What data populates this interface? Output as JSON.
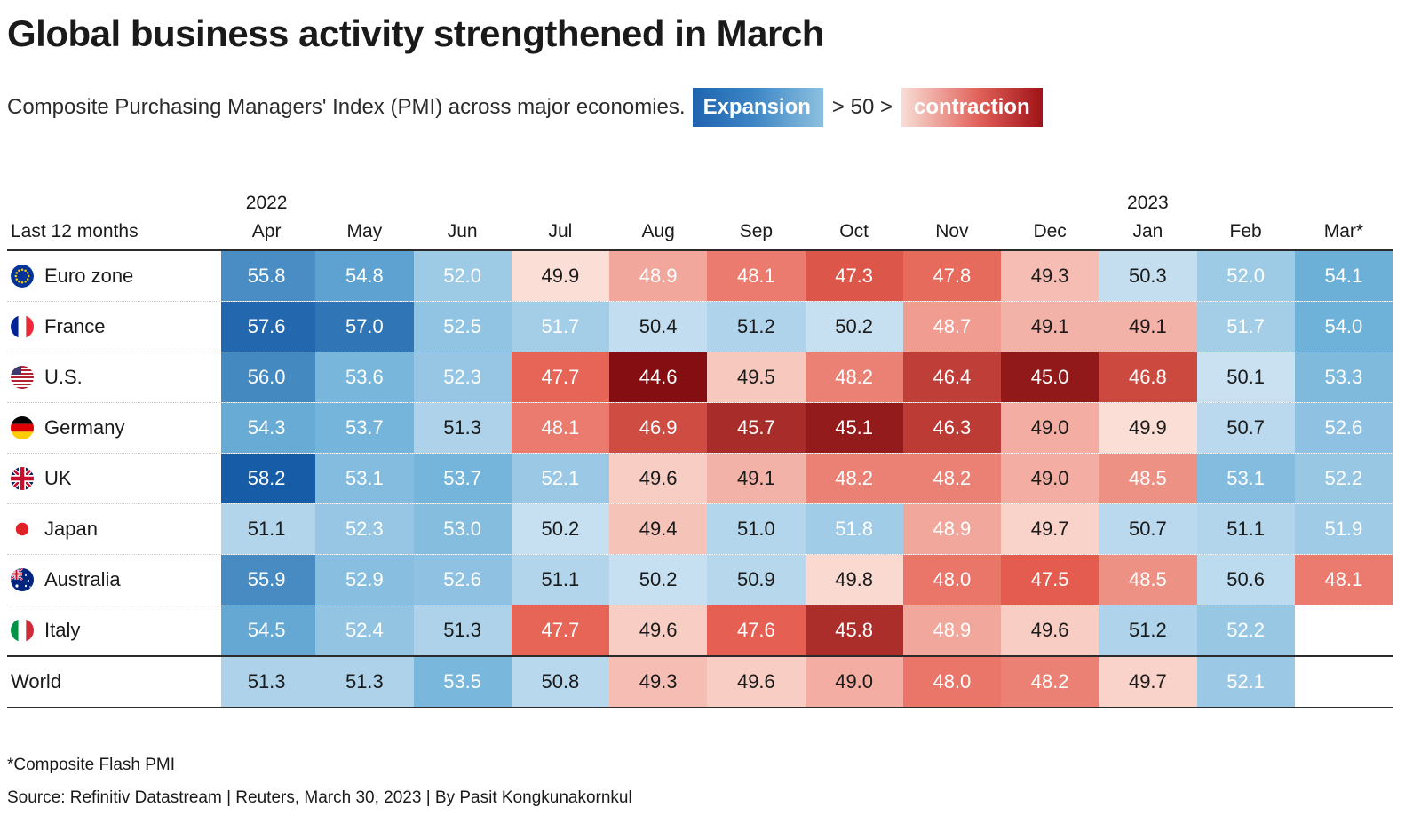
{
  "header": {
    "title": "Global business activity strengthened in March",
    "subtitle": "Composite Purchasing Managers' Index (PMI) across major economies.",
    "legend": {
      "expansion_label": "Expansion",
      "middle_label": "> 50 >",
      "contraction_label": "contraction",
      "expansion_color_dark": "#1f63ae",
      "expansion_color_light": "#8cc0e0",
      "contraction_color_light": "#f8ded6",
      "contraction_color_dark": "#a01217"
    }
  },
  "footer": {
    "footnote": "*Composite Flash PMI",
    "source": "Source: Refinitiv Datastream | Reuters, March 30, 2023 | By Pasit Kongkunakornkul"
  },
  "chart_data": {
    "type": "heatmap",
    "title": "Global business activity strengthened in March",
    "subtitle": "Composite Purchasing Managers' Index (PMI) across major economies.",
    "xlabel": "",
    "ylabel": "",
    "row_header_label": "Last 12 months",
    "year_labels": [
      {
        "text": "2022",
        "column": "Apr"
      },
      {
        "text": "2023",
        "column": "Jan"
      }
    ],
    "categories": [
      "Apr",
      "May",
      "Jun",
      "Jul",
      "Aug",
      "Sep",
      "Oct",
      "Nov",
      "Dec",
      "Jan",
      "Feb",
      "Mar*"
    ],
    "rows": [
      {
        "name": "Euro zone",
        "flag": "eu-flag-icon",
        "values": [
          55.8,
          54.8,
          52.0,
          49.9,
          48.9,
          48.1,
          47.3,
          47.8,
          49.3,
          50.3,
          52.0,
          54.1
        ]
      },
      {
        "name": "France",
        "flag": "france-flag-icon",
        "values": [
          57.6,
          57.0,
          52.5,
          51.7,
          50.4,
          51.2,
          50.2,
          48.7,
          49.1,
          49.1,
          51.7,
          54.0
        ]
      },
      {
        "name": "U.S.",
        "flag": "usa-flag-icon",
        "values": [
          56.0,
          53.6,
          52.3,
          47.7,
          44.6,
          49.5,
          48.2,
          46.4,
          45.0,
          46.8,
          50.1,
          53.3
        ]
      },
      {
        "name": "Germany",
        "flag": "germany-flag-icon",
        "values": [
          54.3,
          53.7,
          51.3,
          48.1,
          46.9,
          45.7,
          45.1,
          46.3,
          49.0,
          49.9,
          50.7,
          52.6
        ]
      },
      {
        "name": "UK",
        "flag": "uk-flag-icon",
        "values": [
          58.2,
          53.1,
          53.7,
          52.1,
          49.6,
          49.1,
          48.2,
          48.2,
          49.0,
          48.5,
          53.1,
          52.2
        ]
      },
      {
        "name": "Japan",
        "flag": "japan-flag-icon",
        "values": [
          51.1,
          52.3,
          53.0,
          50.2,
          49.4,
          51.0,
          51.8,
          48.9,
          49.7,
          50.7,
          51.1,
          51.9
        ]
      },
      {
        "name": "Australia",
        "flag": "australia-flag-icon",
        "values": [
          55.9,
          52.9,
          52.6,
          51.1,
          50.2,
          50.9,
          49.8,
          48.0,
          47.5,
          48.5,
          50.6,
          48.1
        ]
      },
      {
        "name": "Italy",
        "flag": "italy-flag-icon",
        "values": [
          54.5,
          52.4,
          51.3,
          47.7,
          49.6,
          47.6,
          45.8,
          48.9,
          49.6,
          51.2,
          52.2,
          null
        ]
      },
      {
        "name": "World",
        "flag": null,
        "values": [
          51.3,
          51.3,
          53.5,
          50.8,
          49.3,
          49.6,
          49.0,
          48.0,
          48.2,
          49.7,
          52.1,
          null
        ]
      }
    ],
    "threshold": 50,
    "scale": {
      "min": 44.6,
      "max": 58.2,
      "expansion_dark": "#1f63ae",
      "expansion_light": "#cfe4f2",
      "contraction_light": "#fbe3da",
      "contraction_dark": "#8b1013"
    },
    "legend_position": "top"
  }
}
